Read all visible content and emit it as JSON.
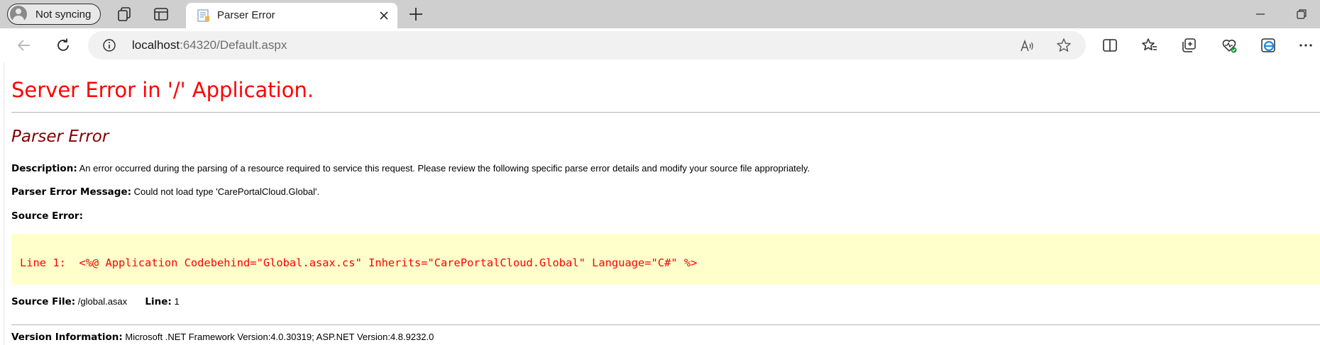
{
  "browser": {
    "profile": {
      "label": "Not syncing"
    },
    "tab": {
      "title": "Parser Error"
    },
    "address": {
      "host": "localhost",
      "path": ":64320/Default.aspx"
    }
  },
  "page": {
    "title": "Server Error in '/' Application.",
    "subtitle": "Parser Error",
    "description_label": "Description:",
    "description_text": "An error occurred during the parsing of a resource required to service this request. Please review the following specific parse error details and modify your source file appropriately.",
    "parser_message_label": "Parser Error Message:",
    "parser_message_text": "Could not load type 'CarePortalCloud.Global'.",
    "source_error_label": "Source Error:",
    "source_code": "Line 1:  <%@ Application Codebehind=\"Global.asax.cs\" Inherits=\"CarePortalCloud.Global\" Language=\"C#\" %>",
    "source_file_label": "Source File:",
    "source_file_value": "/global.asax",
    "line_label": "Line:",
    "line_value": "1",
    "version_label": "Version Information:",
    "version_text": "Microsoft .NET Framework Version:4.0.30319; ASP.NET Version:4.8.9232.0"
  },
  "colors": {
    "title": "#ff0000",
    "subtitle": "#800000",
    "code_background": "#ffffcc",
    "code_text": "#ff0000",
    "tab_strip": "#cfcfcf"
  }
}
